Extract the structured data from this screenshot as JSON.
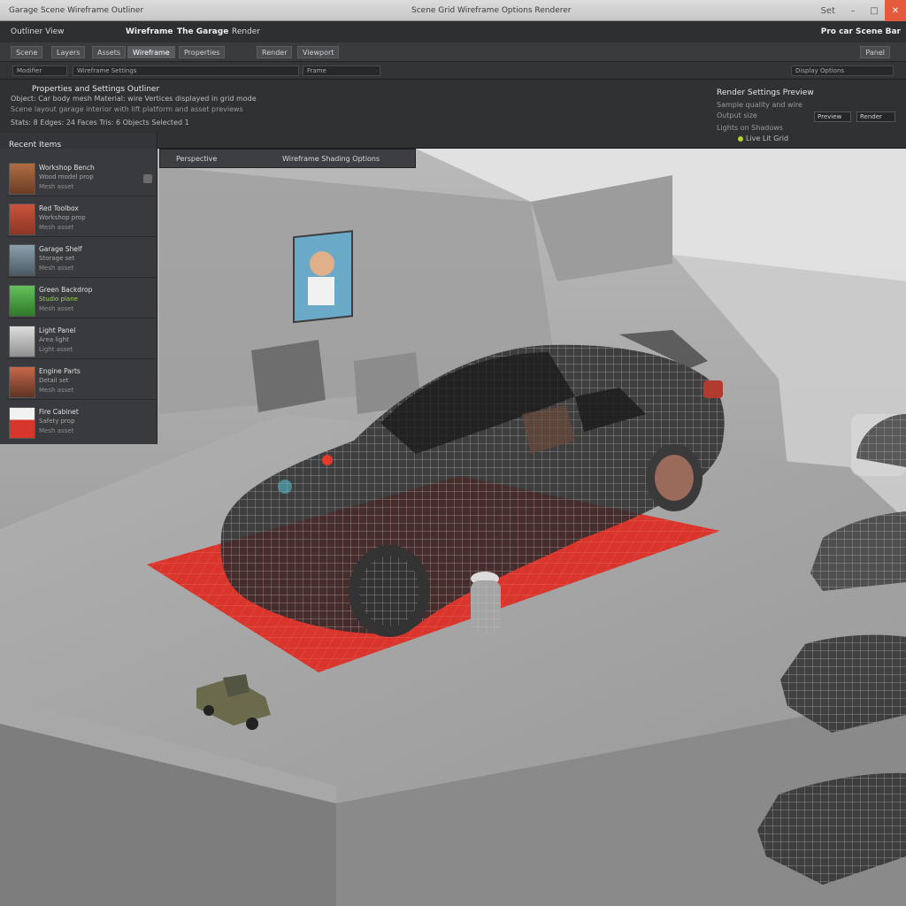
{
  "titlebar": {
    "doc_title": "Garage Scene Wireframe Outliner",
    "status_text": "Scene Grid Wireframe Options Renderer",
    "user_label": "Set"
  },
  "menubar": {
    "left_label": "Outliner View",
    "app_name": "Wireframe",
    "workspace": "The Garage",
    "mode": "Render",
    "right_label": "Pro car Scene Bar"
  },
  "tabs": [
    "Scene",
    "Layers",
    "Assets",
    "Wireframe",
    "Properties",
    "Render",
    "Viewport"
  ],
  "tabs_right": "Panel",
  "options": {
    "field_1": "Modifier",
    "field_2": "Wireframe Settings",
    "field_3": "Frame",
    "field_4": "Display Options"
  },
  "info": {
    "heading": "Properties and Settings Outliner",
    "line_1": "Object: Car body mesh  Material: wire  Vertices displayed in grid mode",
    "line_2": "Scene layout garage interior with lift platform and asset previews",
    "line_3": "Stats: 8  Edges: 24  Faces  Tris: 6  Objects  Selected  1",
    "right_head": "Render Settings Preview",
    "right_line_1": "Sample quality and wire",
    "right_line_2": "Output size",
    "right_line_3": "Lights on  Shadows",
    "stepper_1": "Preview",
    "stepper_2": "Render",
    "legend": "Live  Lit  Grid"
  },
  "sidebar": {
    "title": "Recent Items",
    "assets": [
      {
        "name": "Workshop Bench",
        "sub": "Wood model prop",
        "meta": "Mesh asset"
      },
      {
        "name": "Red Toolbox",
        "sub": "Workshop prop",
        "meta": "Mesh asset"
      },
      {
        "name": "Garage Shelf",
        "sub": "Storage set",
        "meta": "Mesh asset"
      },
      {
        "name": "Green Backdrop",
        "sub": "Studio plane",
        "meta": "Mesh asset"
      },
      {
        "name": "Light Panel",
        "sub": "Area light",
        "meta": "Light asset"
      },
      {
        "name": "Engine Parts",
        "sub": "Detail set",
        "meta": "Mesh asset"
      },
      {
        "name": "Fire Cabinet",
        "sub": "Safety prop",
        "meta": "Mesh asset"
      }
    ]
  },
  "viewport": {
    "toolbar_1": "Perspective",
    "toolbar_2": "Wireframe Shading Options"
  },
  "colors": {
    "platform": "#d9352c",
    "close_button": "#e55a3c",
    "panel_dark": "#303133"
  }
}
